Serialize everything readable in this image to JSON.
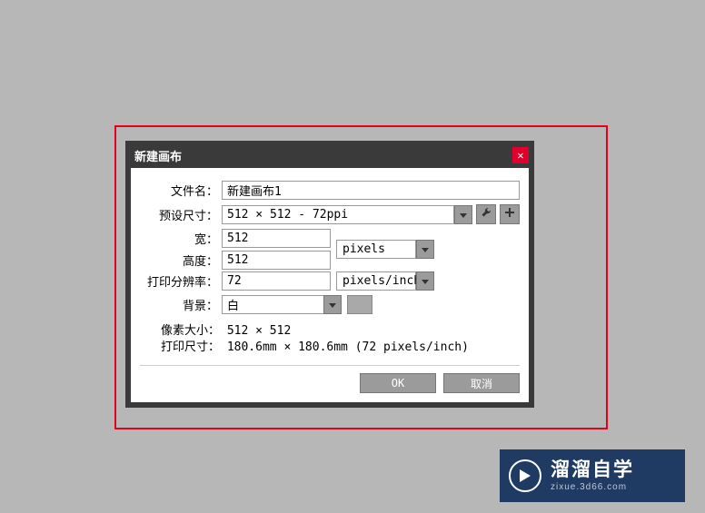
{
  "dialog": {
    "title": "新建画布"
  },
  "form": {
    "filename_label": "文件名：",
    "filename_value": "新建画布1",
    "preset_label": "预设尺寸：",
    "preset_value": "512 × 512 - 72ppi",
    "width_label": "宽：",
    "width_value": "512",
    "height_label": "高度：",
    "height_value": "512",
    "size_unit": "pixels",
    "resolution_label": "打印分辨率：",
    "resolution_value": "72",
    "resolution_unit": "pixels/inch",
    "background_label": "背景：",
    "background_value": "白"
  },
  "info": {
    "pixel_size_label": "像素大小：",
    "pixel_size_value": "512 × 512",
    "print_size_label": "打印尺寸：",
    "print_size_value": "180.6mm × 180.6mm (72 pixels/inch)"
  },
  "buttons": {
    "ok": "OK",
    "cancel": "取消"
  },
  "watermark": {
    "title": "溜溜自学",
    "sub": "zixue.3d66.com"
  }
}
